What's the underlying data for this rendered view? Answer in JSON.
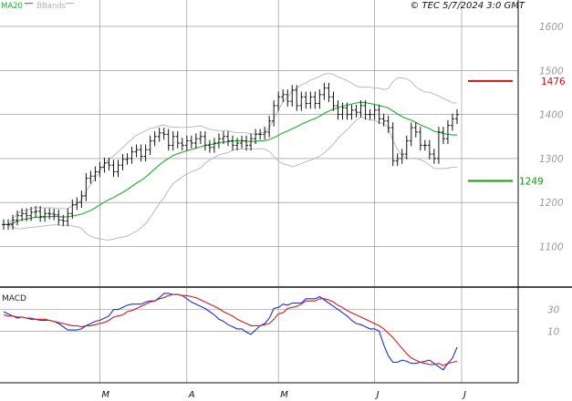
{
  "header": {
    "legend_ma20": "MA20",
    "legend_bbands": "BBands",
    "caption": "© TEC 5/7/2024 3:0 GMT"
  },
  "colors": {
    "price": "#111111",
    "ma20": "#1fae2a",
    "bbands": "#b4b4b4",
    "macd": "#1a2fd6",
    "signal": "#d21b1b",
    "level_red": "#c81414",
    "level_green": "#119a11",
    "grid": "#8a8a8a",
    "tick_text": "#9a9a9a"
  },
  "chart_data": [
    {
      "type": "ohlc",
      "panel": "price",
      "title": "",
      "x_ticks": [
        {
          "label": "M",
          "at": 21
        },
        {
          "label": "A",
          "at": 40
        },
        {
          "label": "M",
          "at": 60
        },
        {
          "label": "J",
          "at": 81
        },
        {
          "label": "J",
          "at": 100
        }
      ],
      "y_ticks": [
        1100,
        1200,
        1300,
        1400,
        1500,
        1600
      ],
      "ylim": [
        1010,
        1660
      ],
      "close": [
        1150,
        1150,
        1160,
        1170,
        1175,
        1170,
        1178,
        1180,
        1168,
        1175,
        1174,
        1172,
        1160,
        1158,
        1175,
        1195,
        1200,
        1215,
        1255,
        1260,
        1270,
        1280,
        1290,
        1285,
        1270,
        1285,
        1298,
        1300,
        1315,
        1320,
        1305,
        1320,
        1340,
        1350,
        1358,
        1355,
        1330,
        1350,
        1335,
        1330,
        1340,
        1335,
        1345,
        1350,
        1330,
        1325,
        1335,
        1345,
        1350,
        1340,
        1330,
        1335,
        1340,
        1330,
        1345,
        1355,
        1355,
        1360,
        1385,
        1420,
        1440,
        1445,
        1430,
        1455,
        1420,
        1440,
        1425,
        1440,
        1425,
        1445,
        1460,
        1440,
        1420,
        1400,
        1415,
        1400,
        1410,
        1405,
        1420,
        1400,
        1400,
        1410,
        1390,
        1385,
        1370,
        1295,
        1300,
        1310,
        1340,
        1370,
        1360,
        1330,
        1330,
        1310,
        1300,
        1360,
        1345,
        1375,
        1390,
        1400
      ],
      "reference_levels": [
        {
          "value": 1476,
          "label": "1476",
          "color": "#c81414"
        },
        {
          "value": 1249,
          "label": "1249",
          "color": "#119a11"
        }
      ],
      "series": [
        {
          "name": "MA20",
          "kind": "moving_average",
          "period": 20
        },
        {
          "name": "BBands",
          "kind": "bollinger",
          "period": 20,
          "stdev": 2
        }
      ],
      "grid": true
    },
    {
      "type": "line",
      "panel": "macd",
      "title": "MACD",
      "y_ticks": [
        {
          "label": "30",
          "value": 30
        },
        {
          "label": "10",
          "value": 10
        }
      ],
      "ylim": [
        -38,
        50
      ],
      "series": [
        {
          "values": [
            28,
            26,
            24,
            22,
            23,
            22,
            21,
            21,
            20,
            20,
            20,
            19,
            17,
            14,
            11,
            11,
            11,
            12,
            15,
            17,
            19,
            20,
            22,
            24,
            30,
            30,
            32,
            34,
            35,
            35,
            35,
            37,
            38,
            38,
            41,
            45,
            45,
            44,
            44,
            43,
            40,
            37,
            35,
            33,
            31,
            28,
            25,
            21,
            19,
            16,
            14,
            12,
            12,
            9,
            7,
            11,
            15,
            17,
            22,
            31,
            32,
            35,
            34,
            36,
            36,
            36,
            40,
            40,
            40,
            42,
            39,
            36,
            33,
            30,
            27,
            24,
            20,
            17,
            16,
            14,
            12,
            12,
            10,
            -3,
            -13,
            -19,
            -19,
            -17,
            -18,
            -20,
            -20,
            -19,
            -18,
            -17,
            -20,
            -23,
            -26,
            -20,
            -15,
            -5
          ]
        },
        {
          "values": [
            25,
            24,
            24,
            23,
            23,
            22,
            22,
            21,
            21,
            21,
            20,
            19,
            18,
            17,
            16,
            15,
            15,
            14,
            15,
            15,
            16,
            17,
            18,
            20,
            23,
            24,
            25,
            28,
            29,
            31,
            33,
            35,
            37,
            38,
            40,
            41,
            43,
            44,
            44,
            43,
            43,
            42,
            41,
            39,
            37,
            35,
            33,
            31,
            28,
            26,
            24,
            21,
            19,
            17,
            15,
            15,
            15,
            16,
            17,
            21,
            26,
            27,
            31,
            32,
            33,
            35,
            38,
            38,
            38,
            40,
            40,
            39,
            37,
            34,
            32,
            29,
            27,
            25,
            23,
            21,
            19,
            17,
            15,
            12,
            8,
            4,
            -1,
            -6,
            -11,
            -15,
            -17,
            -19,
            -20,
            -21,
            -21,
            -20,
            -22,
            -20,
            -19,
            -18
          ]
        }
      ],
      "grid": true
    }
  ]
}
